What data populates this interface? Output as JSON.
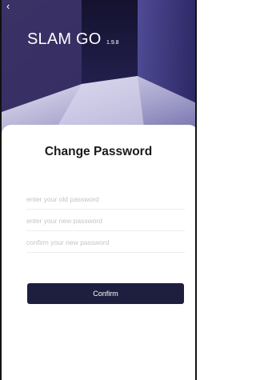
{
  "header": {
    "back_icon": "chevron-left-icon",
    "back_glyph": "‹",
    "app_name": "SLAM GO",
    "version": "1.9.8"
  },
  "form": {
    "title": "Change Password",
    "old_password_placeholder": "enter your old password",
    "new_password_placeholder": "enter your new password",
    "confirm_password_placeholder": "confirm your new password",
    "confirm_label": "Confirm"
  },
  "colors": {
    "button": "#1e1f3f",
    "hero_background": "#2a2452"
  }
}
